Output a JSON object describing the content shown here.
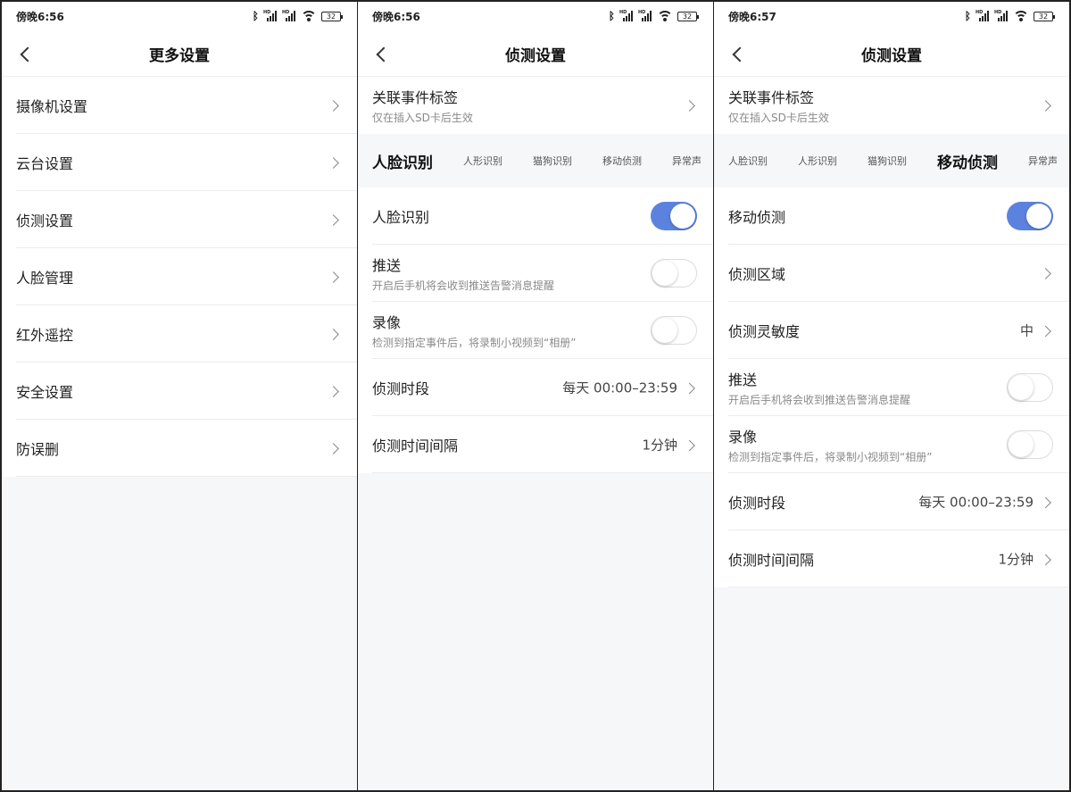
{
  "status_bar": {
    "p1_time": "傍晚6:56",
    "p2_time": "傍晚6:56",
    "p3_time": "傍晚6:57",
    "battery": "32",
    "signal_tag": "HD"
  },
  "panel1": {
    "title": "更多设置",
    "items": [
      {
        "label": "摄像机设置"
      },
      {
        "label": "云台设置"
      },
      {
        "label": "侦测设置"
      },
      {
        "label": "人脸管理"
      },
      {
        "label": "红外遥控"
      },
      {
        "label": "安全设置"
      },
      {
        "label": "防误删"
      }
    ]
  },
  "panel2": {
    "title": "侦测设置",
    "event_tag": {
      "label": "关联事件标签",
      "sub": "仅在插入SD卡后生效"
    },
    "tabs": [
      "人脸识别",
      "人形识别",
      "猫狗识别",
      "移动侦测",
      "异常声"
    ],
    "active_tab": 0,
    "rows": {
      "face": {
        "label": "人脸识别",
        "on": true
      },
      "push": {
        "label": "推送",
        "sub": "开启后手机将会收到推送告警消息提醒",
        "on": false
      },
      "record": {
        "label": "录像",
        "sub": "检测到指定事件后，将录制小视频到“相册”",
        "on": false
      },
      "period": {
        "label": "侦测时段",
        "value": "每天 00:00–23:59"
      },
      "interval": {
        "label": "侦测时间间隔",
        "value": "1分钟"
      }
    }
  },
  "panel3": {
    "title": "侦测设置",
    "event_tag": {
      "label": "关联事件标签",
      "sub": "仅在插入SD卡后生效"
    },
    "tabs": [
      "人脸识别",
      "人形识别",
      "猫狗识别",
      "移动侦测",
      "异常声"
    ],
    "active_tab": 3,
    "rows": {
      "motion": {
        "label": "移动侦测",
        "on": true
      },
      "area": {
        "label": "侦测区域"
      },
      "sensitivity": {
        "label": "侦测灵敏度",
        "value": "中"
      },
      "push": {
        "label": "推送",
        "sub": "开启后手机将会收到推送告警消息提醒",
        "on": false
      },
      "record": {
        "label": "录像",
        "sub": "检测到指定事件后，将录制小视频到“相册”",
        "on": false
      },
      "period": {
        "label": "侦测时段",
        "value": "每天 00:00–23:59"
      },
      "interval": {
        "label": "侦测时间间隔",
        "value": "1分钟"
      }
    }
  },
  "colors": {
    "accent": "#5b82de",
    "background": "#f6f7f9"
  },
  "icons": [
    "back-arrow-icon",
    "chevron-right-icon",
    "bluetooth-icon",
    "signal-icon",
    "wifi-icon",
    "battery-icon"
  ]
}
